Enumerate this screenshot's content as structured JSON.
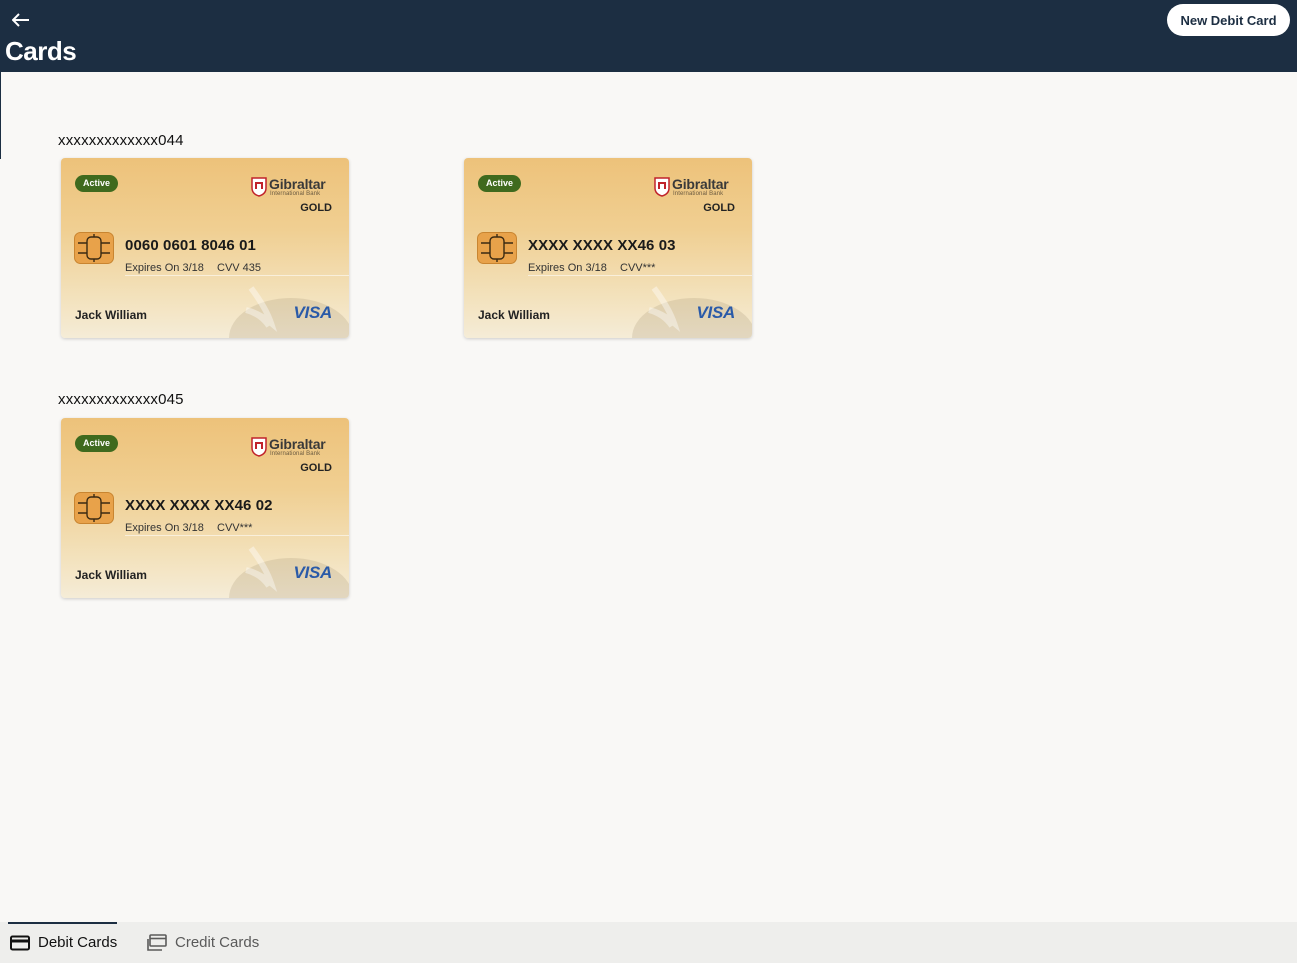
{
  "header": {
    "title": "Cards",
    "new_card_label": "New Debit Card"
  },
  "accounts": [
    {
      "number": "xxxxxxxxxxxxx044",
      "cards": [
        {
          "status": "Active",
          "bank_name": "Gibraltar",
          "bank_sub": "International Bank",
          "tier": "GOLD",
          "number": "0060 0601 8046 01",
          "expiry": "Expires On 3/18",
          "cvv": "CVV 435",
          "holder": "Jack William",
          "network": "VISA"
        },
        {
          "status": "Active",
          "bank_name": "Gibraltar",
          "bank_sub": "International Bank",
          "tier": "GOLD",
          "number": "XXXX XXXX XX46 03",
          "expiry": "Expires On 3/18",
          "cvv": "CVV***",
          "holder": "Jack William",
          "network": "VISA"
        }
      ]
    },
    {
      "number": "xxxxxxxxxxxxx045",
      "cards": [
        {
          "status": "Active",
          "bank_name": "Gibraltar",
          "bank_sub": "International Bank",
          "tier": "GOLD",
          "number": "XXXX XXXX XX46 02",
          "expiry": "Expires On 3/18",
          "cvv": "CVV***",
          "holder": "Jack William",
          "network": "VISA"
        }
      ]
    }
  ],
  "tabs": [
    {
      "label": "Debit Cards",
      "icon": "credit-card-icon",
      "selected": true
    },
    {
      "label": "Credit Cards",
      "icon": "credit-card-outline-icon",
      "selected": false
    }
  ],
  "colors": {
    "header_bg": "#1c2e42",
    "status_active": "#3f6a1e",
    "visa_blue": "#2a5aa8",
    "page_bg": "#f9f8f6"
  }
}
